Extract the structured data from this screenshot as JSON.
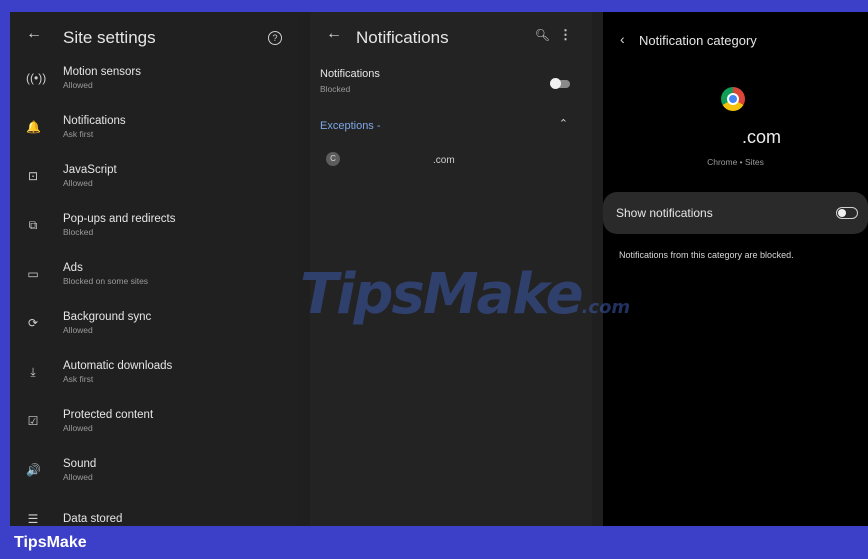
{
  "site_settings": {
    "title": "Site settings",
    "items": [
      {
        "icon": "motion-sensor-icon",
        "glyph": "((•))",
        "label": "Motion sensors",
        "status": "Allowed"
      },
      {
        "icon": "bell-icon",
        "glyph": "🔔",
        "label": "Notifications",
        "status": "Ask first"
      },
      {
        "icon": "javascript-icon",
        "glyph": "⊡",
        "label": "JavaScript",
        "status": "Allowed"
      },
      {
        "icon": "popup-icon",
        "glyph": "⧉",
        "label": "Pop-ups and redirects",
        "status": "Blocked"
      },
      {
        "icon": "ads-icon",
        "glyph": "▭",
        "label": "Ads",
        "status": "Blocked on some sites"
      },
      {
        "icon": "sync-icon",
        "glyph": "⟳",
        "label": "Background sync",
        "status": "Allowed"
      },
      {
        "icon": "download-icon",
        "glyph": "⤓",
        "label": "Automatic downloads",
        "status": "Ask first"
      },
      {
        "icon": "protected-content-icon",
        "glyph": "☑",
        "label": "Protected content",
        "status": "Allowed"
      },
      {
        "icon": "sound-icon",
        "glyph": "🔊",
        "label": "Sound",
        "status": "Allowed"
      },
      {
        "icon": "data-stored-icon",
        "glyph": "☰",
        "label": "Data stored",
        "status": ""
      }
    ]
  },
  "notifications": {
    "title": "Notifications",
    "toggle_label": "Notifications",
    "toggle_status": "Blocked",
    "exceptions_label": "Exceptions -",
    "site_domain": ".com",
    "site_initial": "C"
  },
  "category": {
    "title": "Notification category",
    "site_name": ".com",
    "site_sub": "Chrome • Sites",
    "show_label": "Show notifications",
    "blocked_note": "Notifications from this category are blocked."
  },
  "watermark": {
    "main": "TipsMake",
    "suffix": ".com"
  },
  "footer": {
    "brand": "TipsMake"
  },
  "colors": {
    "frame": "#3c3fc7",
    "accent_link": "#7fa7e6"
  }
}
